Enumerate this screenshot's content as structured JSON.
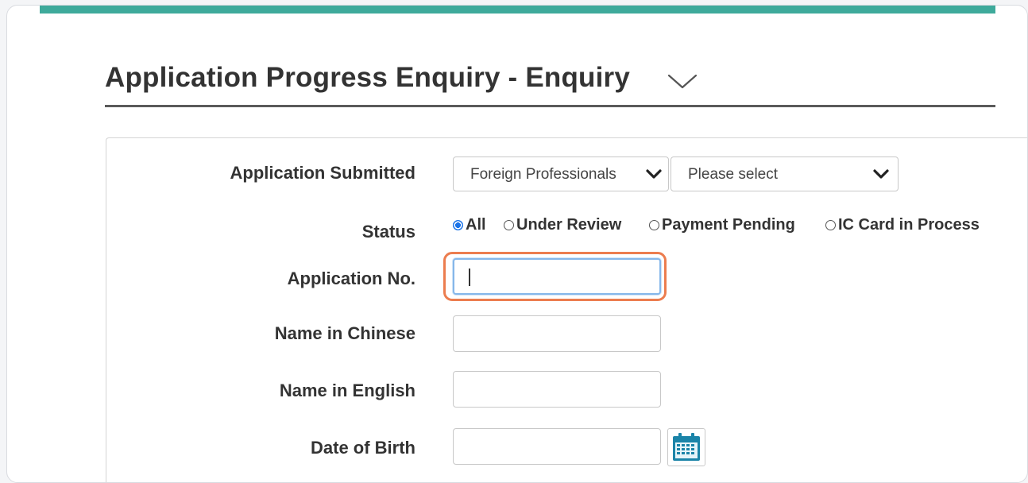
{
  "page": {
    "title": "Application Progress Enquiry - Enquiry",
    "title_icon": "chevron-down-icon",
    "accent_color": "#3eaa9b",
    "focus_color": "#ec7d4f"
  },
  "form": {
    "application_submitted": {
      "label": "Application Submitted",
      "category_select": {
        "value": "Foreign Professionals"
      },
      "type_select": {
        "value": "Please select"
      }
    },
    "status": {
      "label": "Status",
      "options": [
        {
          "label": "All",
          "checked": true
        },
        {
          "label": "Under Review",
          "checked": false
        },
        {
          "label": "Payment Pending",
          "checked": false
        },
        {
          "label": "IC Card in Process",
          "checked": false
        }
      ]
    },
    "application_no": {
      "label": "Application No.",
      "value": "",
      "focused": true
    },
    "name_in_chinese": {
      "label": "Name in Chinese",
      "value": ""
    },
    "name_in_english": {
      "label": "Name in English",
      "value": ""
    },
    "date_of_birth": {
      "label": "Date of Birth",
      "value": "",
      "picker_icon": "calendar-icon"
    }
  }
}
